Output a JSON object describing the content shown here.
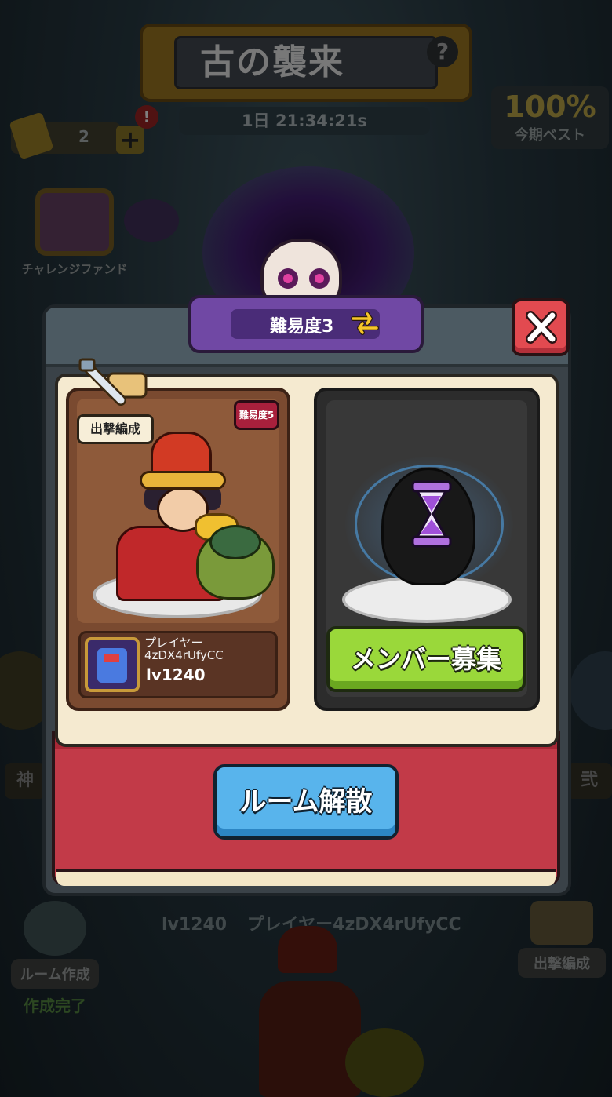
{
  "event": {
    "title": "古の襲来",
    "help_icon": "?",
    "timer": "1日 21:34:21s"
  },
  "ticket": {
    "count": "2",
    "plus": "+",
    "alert": "!"
  },
  "best": {
    "value": "100%",
    "label": "今期ベスト"
  },
  "challenge_fund": {
    "label": "チャレンジファンド"
  },
  "side_tags": {
    "left": "神",
    "right": "弐"
  },
  "modal": {
    "difficulty_label": "難易度3",
    "left_card": {
      "formation_label": "出撃編成",
      "difficulty_badge": "難易度5",
      "player_name_line1": "プレイヤー",
      "player_name_line2": "4zDX4rUfyCC",
      "player_level": "lv1240"
    },
    "right_card": {
      "recruit_label": "メンバー募集"
    },
    "disband_label": "ルーム解散"
  },
  "bottom": {
    "player_level": "lv1240",
    "player_name": "プレイヤー4zDX4rUfyCC",
    "room_create_label": "ルーム作成",
    "room_create_status": "作成完了",
    "formation_label": "出撃編成"
  },
  "colors": {
    "recruit_green": "#9ad83a",
    "disband_blue": "#58b4ec",
    "close_red": "#e24a50",
    "difficulty_purple": "#7048a4",
    "modal_red": "#c23a48"
  }
}
